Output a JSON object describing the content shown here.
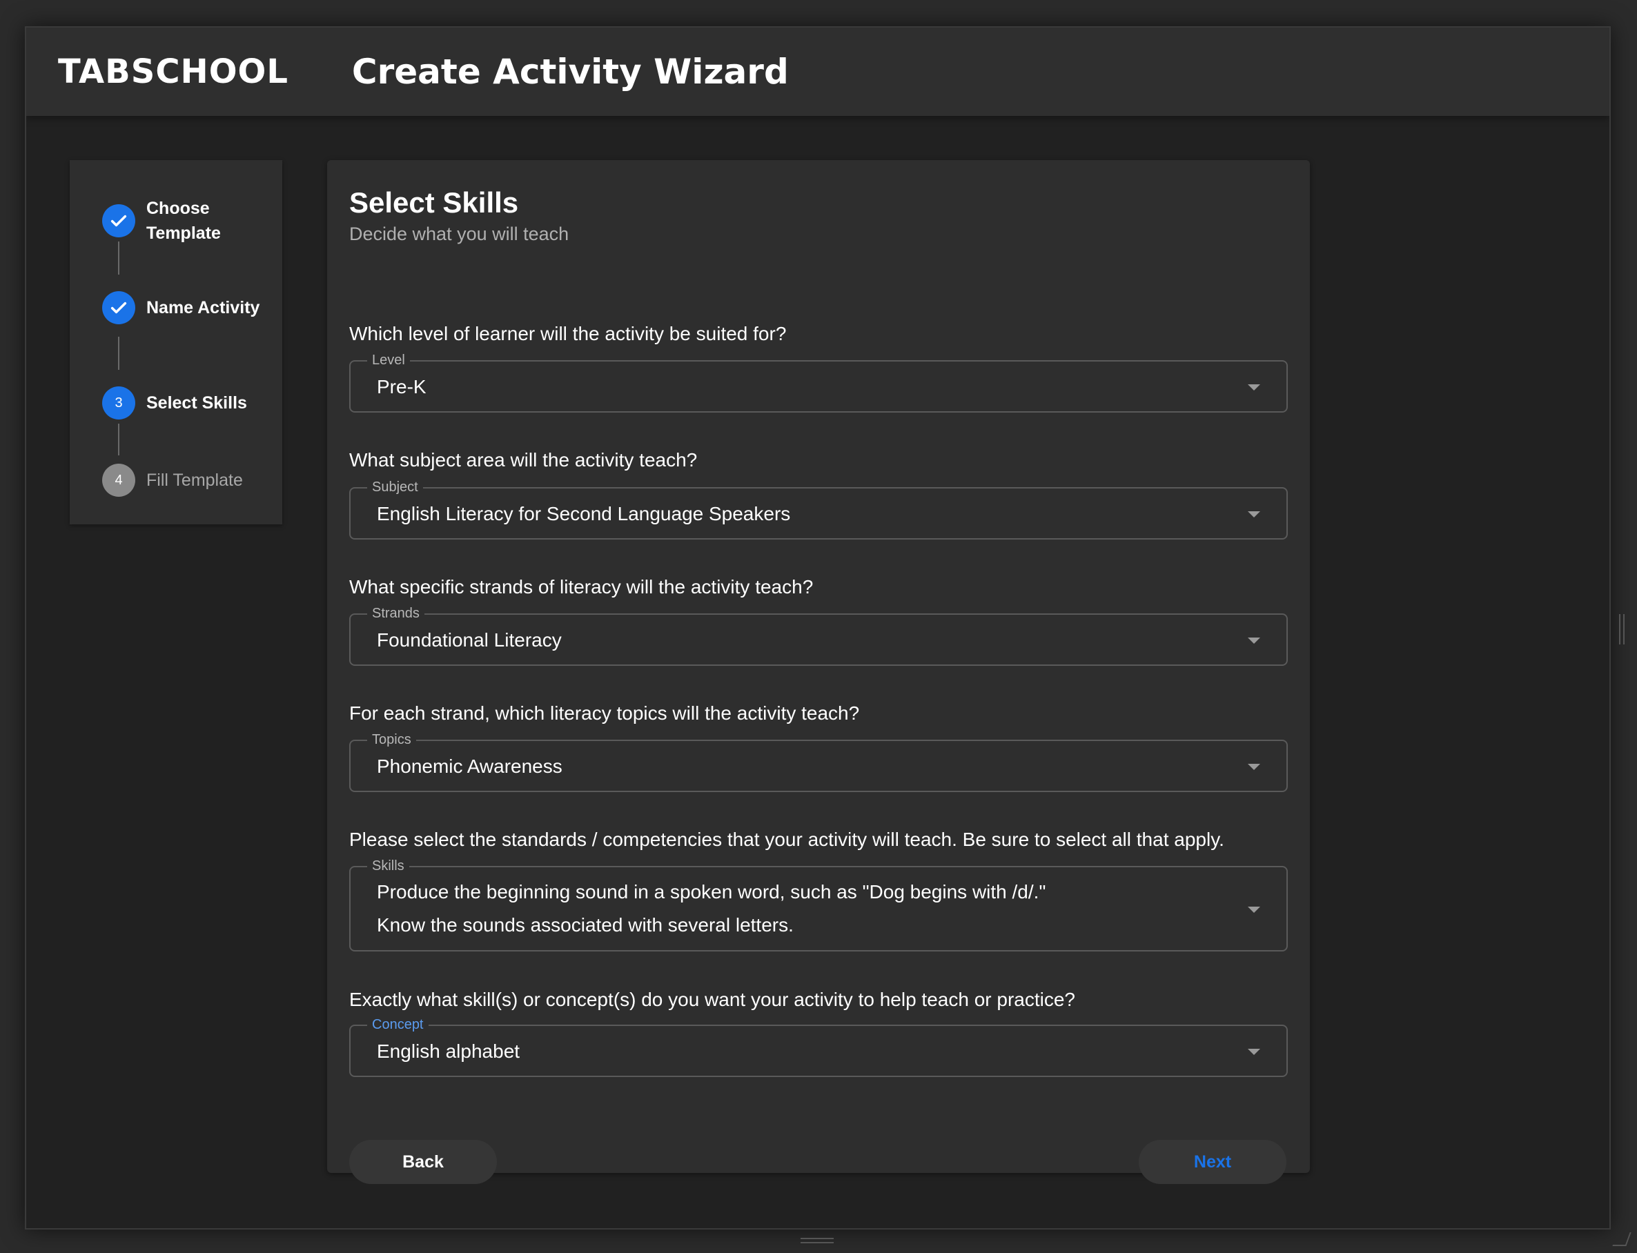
{
  "app": {
    "brand": "TABSCHOOL",
    "title": "Create Activity Wizard"
  },
  "stepper": {
    "steps": [
      {
        "number": "1",
        "label": "Choose Template",
        "state": "done"
      },
      {
        "number": "2",
        "label": "Name Activity",
        "state": "done"
      },
      {
        "number": "3",
        "label": "Select Skills",
        "state": "active"
      },
      {
        "number": "4",
        "label": "Fill Template",
        "state": "pending"
      }
    ]
  },
  "card": {
    "title": "Select Skills",
    "subtitle": "Decide what you will teach"
  },
  "fields": {
    "level": {
      "question": "Which level of learner will the activity be suited for?",
      "label": "Level",
      "value": "Pre-K"
    },
    "subject": {
      "question": "What subject area will the activity teach?",
      "label": "Subject",
      "value": "English Literacy for Second Language Speakers"
    },
    "strands": {
      "question": "What specific strands of literacy will the activity teach?",
      "label": "Strands",
      "value": "Foundational Literacy"
    },
    "topics": {
      "question": "For each strand, which literacy topics will the activity teach?",
      "label": "Topics",
      "value": "Phonemic Awareness"
    },
    "skills": {
      "question": "Please select the standards / competencies that your activity will teach. Be sure to select all that apply.",
      "label": "Skills",
      "values": [
        "Produce the beginning sound in a spoken word, such as \"Dog begins with /d/.\"",
        "Know the sounds associated with several letters."
      ]
    },
    "concept": {
      "question": "Exactly what skill(s) or concept(s) do you want your activity to help teach or practice?",
      "label": "Concept",
      "value": "English alphabet"
    }
  },
  "buttons": {
    "back": "Back",
    "next": "Next"
  },
  "colors": {
    "accent": "#1a73e8",
    "focus_label": "#5b9cf0",
    "pending_step": "#8a8a8a"
  }
}
